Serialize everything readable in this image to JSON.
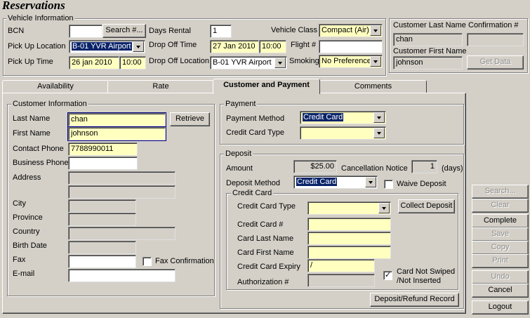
{
  "window": {
    "title": "Reservations"
  },
  "vehicle": {
    "group_label": "Vehicle Information",
    "bcn_label": "BCN",
    "bcn_value": "",
    "search_button": "Search #...",
    "days_rental_label": "Days Rental",
    "days_rental_value": "1",
    "vehicle_class_label": "Vehicle Class",
    "vehicle_class_value": "Compact (Air)",
    "pickup_location_label": "Pick Up Location",
    "pickup_location_value": "B-01 YVR Airport",
    "dropoff_time_label": "Drop Off Time",
    "dropoff_date": "27 Jan 2010",
    "dropoff_time": "10:00",
    "flight_label": "Flight #",
    "flight_value": "",
    "pickup_time_label": "Pick Up Time",
    "pickup_date": "26 jan 2010",
    "pickup_time": "10:00",
    "dropoff_location_label": "Drop Off Location",
    "dropoff_location_value": "B-01 YVR Airport",
    "smoking_label": "Smoking",
    "smoking_value": "No Preference"
  },
  "customer_panel": {
    "last_name_label": "Customer Last Name",
    "last_name_value": "chan",
    "confirmation_label": "Confirmation #",
    "confirmation_value": "",
    "first_name_label": "Customer First Name",
    "first_name_value": "johnson",
    "get_data_button": "Get Data"
  },
  "tabs": [
    {
      "label": "Availability"
    },
    {
      "label": "Rate"
    },
    {
      "label": "Customer and Payment"
    },
    {
      "label": "Comments"
    }
  ],
  "customer_info": {
    "group_label": "Customer Information",
    "last_name_label": "Last Name",
    "last_name_value": "chan",
    "retrieve_button": "Retrieve",
    "first_name_label": "First Name",
    "first_name_value": "johnson",
    "contact_phone_label": "Contact Phone",
    "contact_phone_value": "7788990011",
    "business_phone_label": "Business Phone",
    "business_phone_value": "",
    "address_label": "Address",
    "city_label": "City",
    "province_label": "Province",
    "country_label": "Country",
    "birth_date_label": "Birth Date",
    "fax_label": "Fax",
    "fax_confirmation_label": "Fax Confirmation",
    "email_label": "E-mail"
  },
  "payment": {
    "group_label": "Payment",
    "method_label": "Payment Method",
    "method_value": "Credit Card",
    "cc_type_label": "Credit Card Type",
    "cc_type_value": ""
  },
  "deposit": {
    "group_label": "Deposit",
    "amount_label": "Amount",
    "amount_value": "$25.00",
    "cancellation_label": "Cancellation Notice",
    "cancellation_value": "1",
    "days_label": "(days)",
    "method_label": "Deposit Method",
    "method_value": "Credit Card",
    "waive_label": "Waive Deposit",
    "record_button": "Deposit/Refund Record"
  },
  "credit_card": {
    "group_label": "Credit Card",
    "type_label": "Credit Card Type",
    "collect_button": "Collect Deposit",
    "number_label": "Credit Card #",
    "last_name_label": "Card Last Name",
    "first_name_label": "Card First Name",
    "expiry_label": "Credit Card Expiry",
    "expiry_value": "/",
    "auth_label": "Authorization #",
    "not_swiped_label_1": "Card Not Swiped",
    "not_swiped_label_2": "/Not Inserted",
    "not_swiped_checked": "✓"
  },
  "side_buttons": {
    "search": "Search...",
    "clear": "Clear",
    "complete": "Complete",
    "save": "Save",
    "copy": "Copy",
    "print": "Print",
    "undo": "Undo",
    "cancel": "Cancel",
    "logout": "Logout"
  }
}
